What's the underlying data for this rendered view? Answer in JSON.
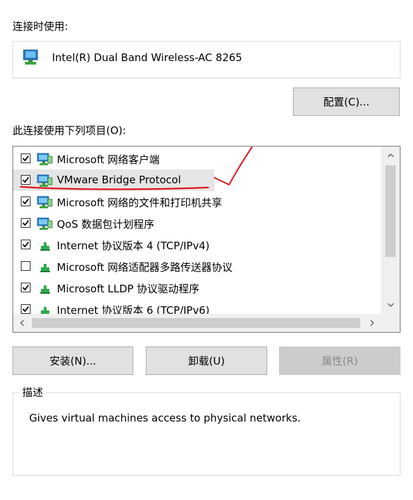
{
  "connect_using_label": "连接时使用:",
  "adapter": {
    "name": "Intel(R) Dual Band Wireless-AC 8265",
    "icon": "network-adapter-icon"
  },
  "configure_button": "配置(C)...",
  "items_label": "此连接使用下列项目(O):",
  "items": [
    {
      "label": "Microsoft 网络客户端",
      "checked": true,
      "icon": "network-client-icon"
    },
    {
      "label": "VMware Bridge Protocol",
      "checked": true,
      "icon": "network-client-icon"
    },
    {
      "label": "Microsoft 网络的文件和打印机共享",
      "checked": true,
      "icon": "network-client-icon"
    },
    {
      "label": "QoS 数据包计划程序",
      "checked": true,
      "icon": "network-client-icon"
    },
    {
      "label": "Internet 协议版本 4 (TCP/IPv4)",
      "checked": true,
      "icon": "protocol-icon"
    },
    {
      "label": "Microsoft 网络适配器多路传送器协议",
      "checked": false,
      "icon": "protocol-icon"
    },
    {
      "label": "Microsoft LLDP 协议驱动程序",
      "checked": true,
      "icon": "protocol-icon"
    },
    {
      "label": "Internet 协议版本 6 (TCP/IPv6)",
      "checked": true,
      "icon": "protocol-icon"
    }
  ],
  "buttons": {
    "install": "安装(N)...",
    "uninstall": "卸载(U)",
    "properties": "属性(R)"
  },
  "description_title": "描述",
  "description_text": "Gives virtual machines access to physical networks.",
  "colors": {
    "annotation": "#e0151d",
    "selected_row": "#e5e5e5",
    "disabled_button": "#cccccc"
  }
}
